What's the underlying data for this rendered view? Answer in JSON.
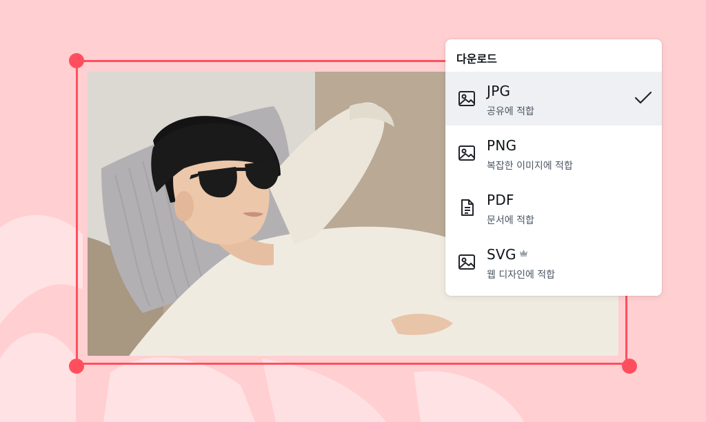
{
  "download_panel": {
    "title": "다운로드",
    "options": [
      {
        "name": "JPG",
        "description": "공유에 적합",
        "icon": "image-icon",
        "selected": true
      },
      {
        "name": "PNG",
        "description": "복잡한 이미지에 적합",
        "icon": "image-icon",
        "selected": false
      },
      {
        "name": "PDF",
        "description": "문서에 적합",
        "icon": "document-icon",
        "selected": false
      },
      {
        "name": "SVG",
        "description": "웹 디자인에 적합",
        "icon": "image-icon",
        "selected": false,
        "badge": "crown-icon"
      }
    ]
  },
  "colors": {
    "background": "#ffcfd1",
    "selection_frame": "#ff4f5e",
    "selected_row": "#eef0f3"
  }
}
